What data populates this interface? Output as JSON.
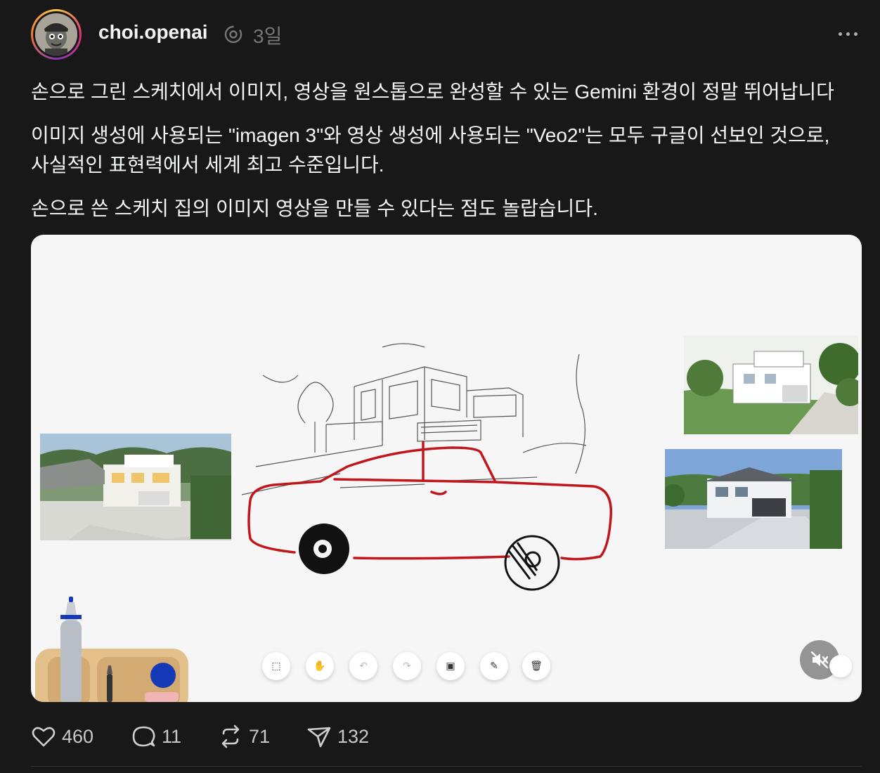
{
  "post": {
    "username": "choi.openai",
    "time": "3일",
    "paragraphs": [
      "손으로 그린 스케치에서 이미지, 영상을 원스톱으로 완성할 수 있는 Gemini 환경이 정말 뛰어납니다",
      "이미지 생성에 사용되는 \"imagen 3\"와 영상 생성에 사용되는 \"Veo2\"는 모두 구글이 선보인 것으로,",
      "사실적인 표현력에서 세계 최고 수준입니다.",
      "손으로 쓴 스케치 집의 이미지 영상을 만들 수 있다는 점도 놀랍습니다."
    ]
  },
  "actions": {
    "likes": "460",
    "comments": "11",
    "reposts": "71",
    "shares": "132"
  },
  "icons": {
    "more": "more-horizontal-icon",
    "like": "heart-icon",
    "comment": "comment-bubble-icon",
    "repost": "repost-icon",
    "share": "send-icon",
    "mute": "volume-muted-icon"
  },
  "colors": {
    "background": "#181818",
    "text": "#f3f5f7",
    "muted_text": "#777777",
    "sketch_red": "#c0161c"
  }
}
